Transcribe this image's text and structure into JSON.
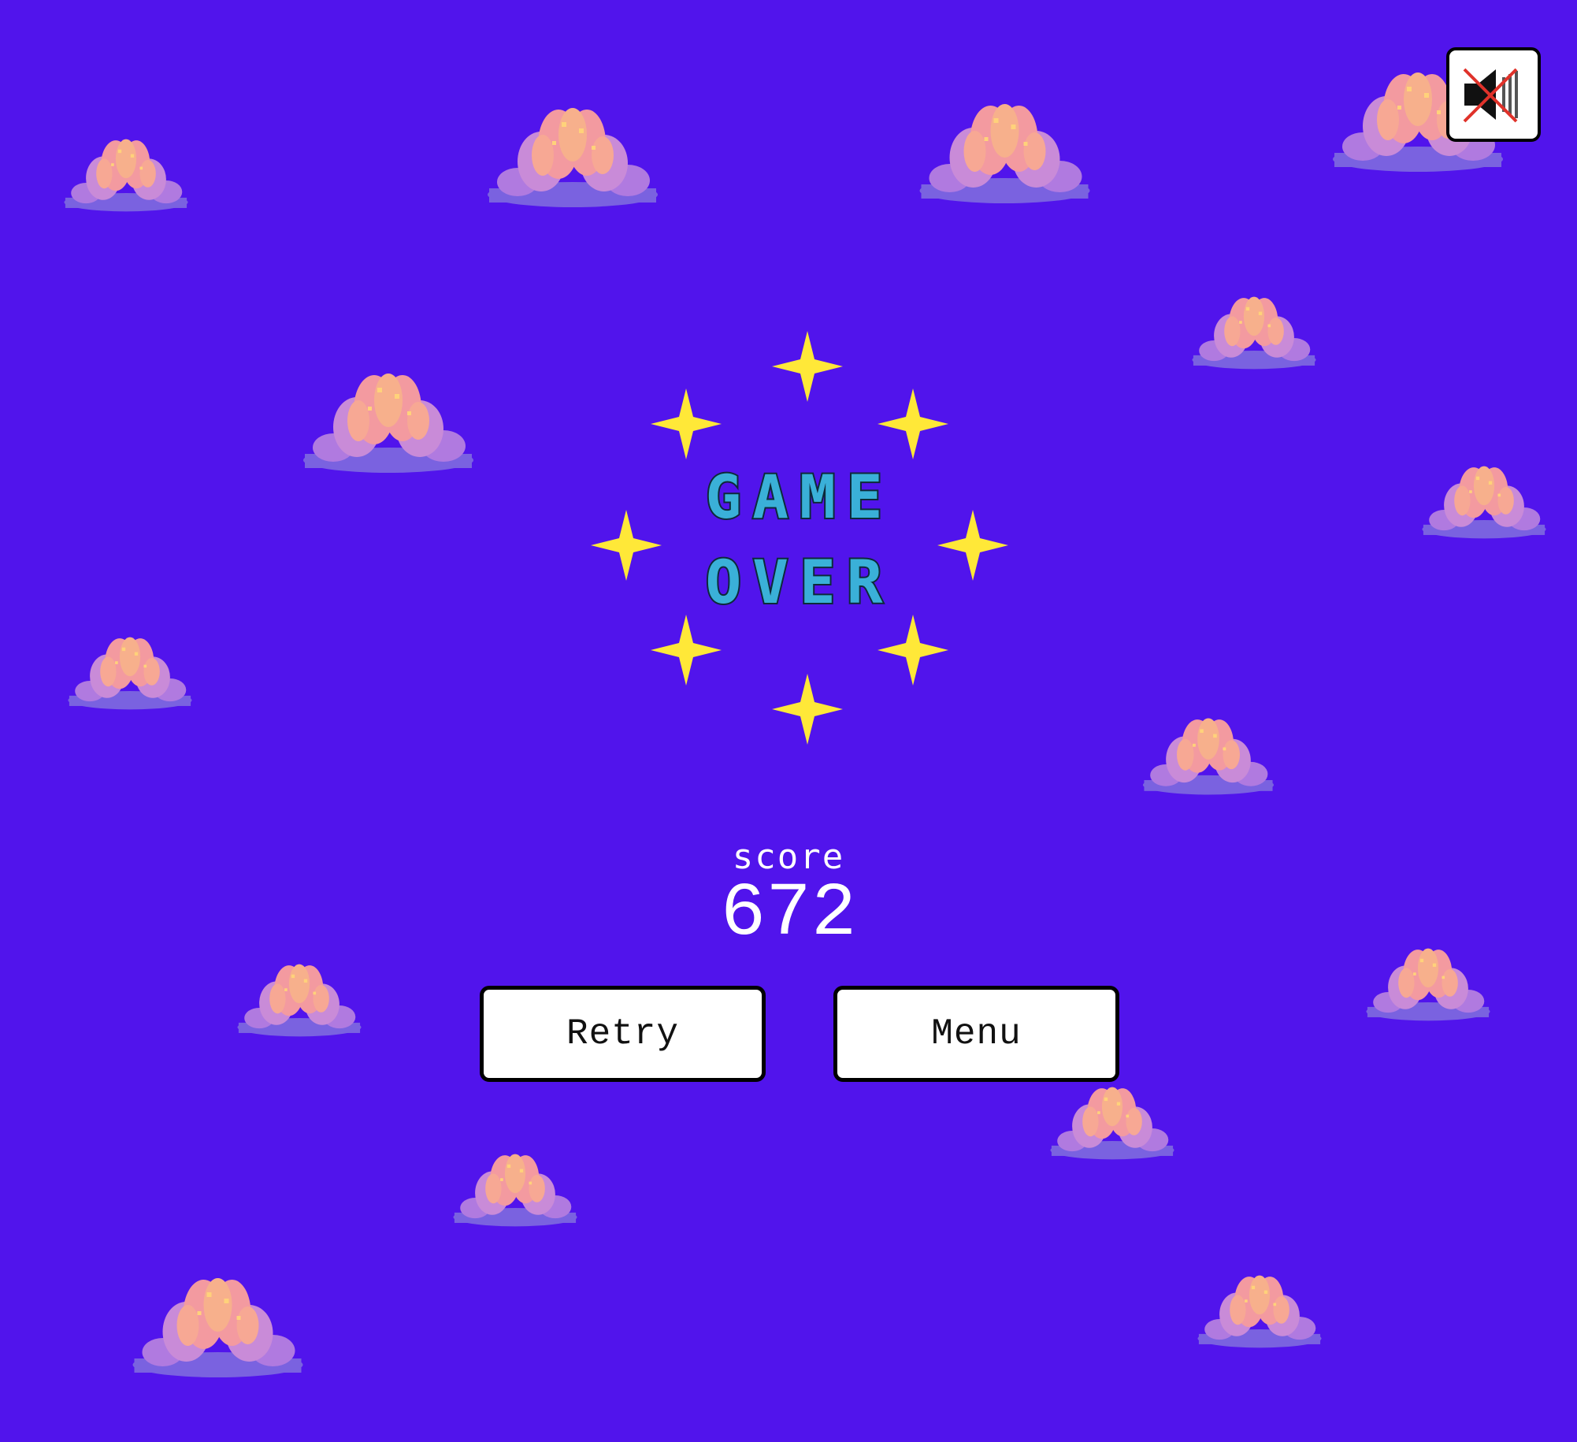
{
  "game": {
    "title_line1": "GAME",
    "title_line2": "OVER",
    "score_label": "score",
    "score_value": "672"
  },
  "buttons": {
    "retry_label": "Retry",
    "menu_label": "Menu"
  },
  "sound": {
    "muted": true,
    "icon": "speaker-muted-icon"
  },
  "colors": {
    "background": "#5114ec",
    "title_fill": "#3ab0d8",
    "star": "#ffe838",
    "cloud_top": "#f39aa0",
    "cloud_base": "#7a62e0"
  }
}
